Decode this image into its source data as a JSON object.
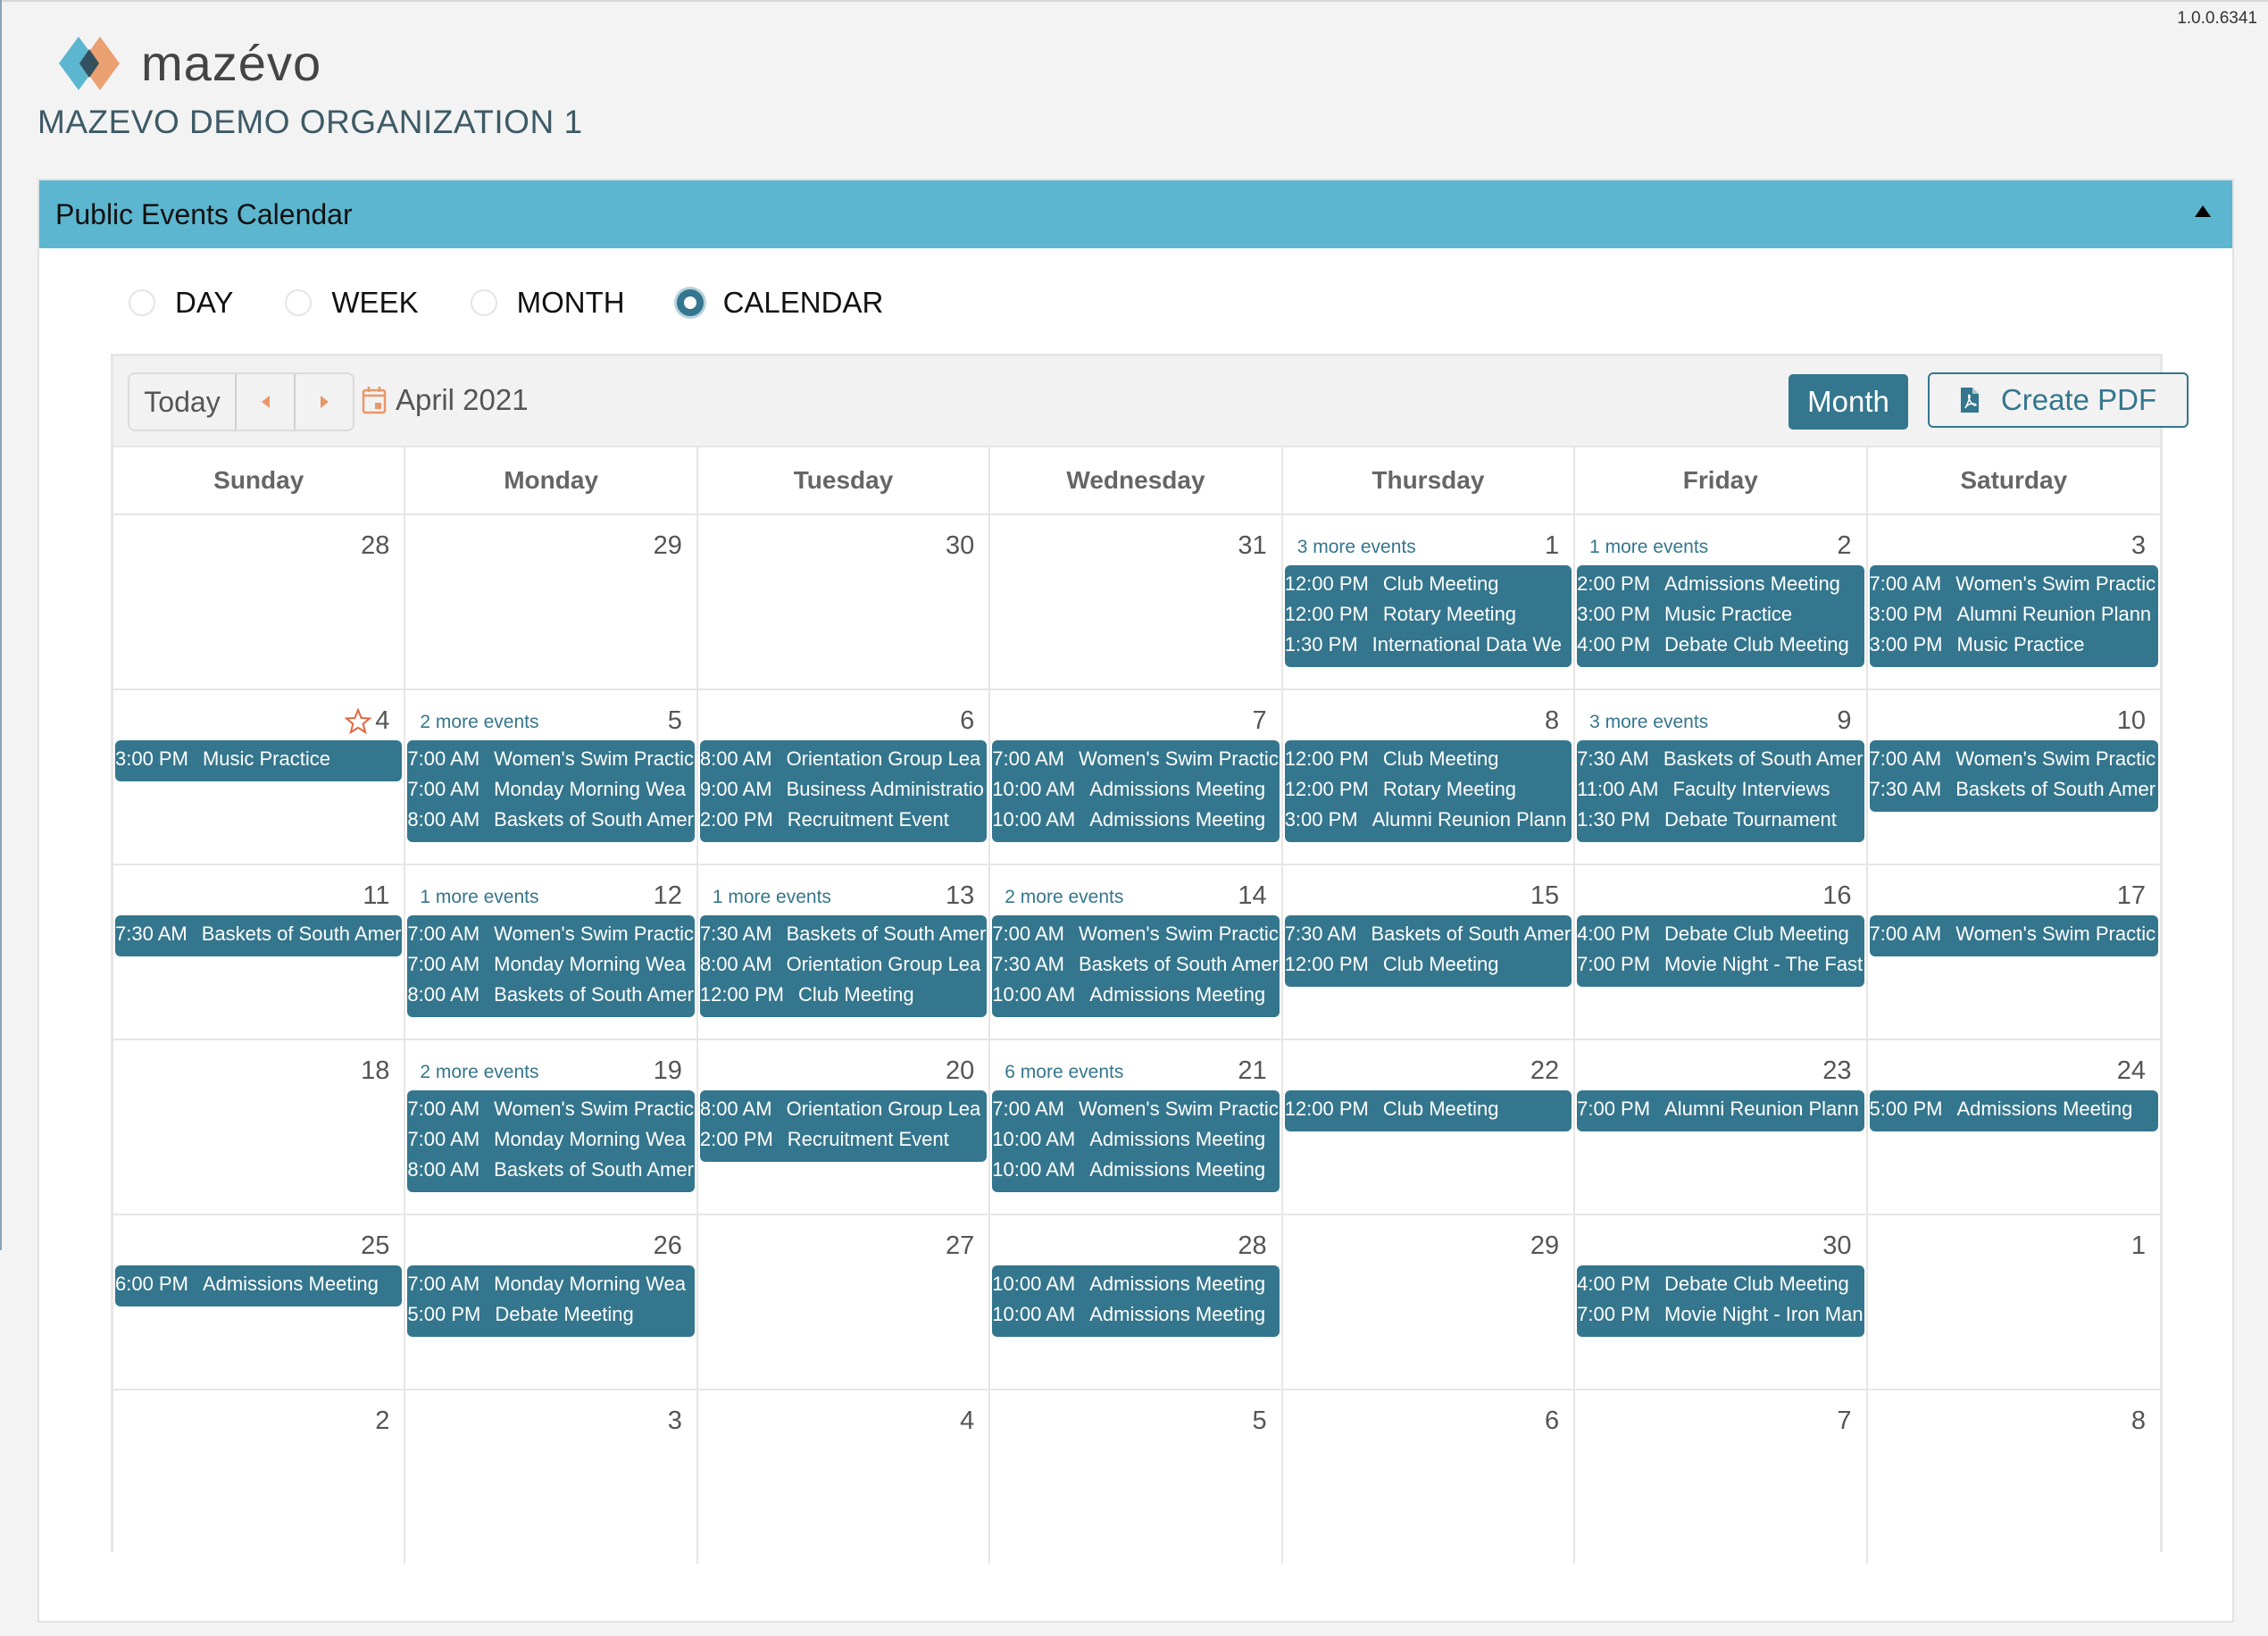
{
  "app": {
    "version": "1.0.0.6341",
    "logo_text": "mazévo",
    "organization": "MAZEVO DEMO ORGANIZATION 1",
    "colors": {
      "header_bar": "#5cb6cf",
      "accent": "#34768d",
      "nav_icon": "#e9976a",
      "star": "#e4663f"
    }
  },
  "panel": {
    "title": "Public Events Calendar",
    "collapse_icon": "triangle-up-icon"
  },
  "view_options": [
    {
      "label": "DAY",
      "checked": false
    },
    {
      "label": "WEEK",
      "checked": false
    },
    {
      "label": "MONTH",
      "checked": false
    },
    {
      "label": "CALENDAR",
      "checked": true
    }
  ],
  "toolbar": {
    "today_label": "Today",
    "prev_icon": "caret-left-icon",
    "next_icon": "caret-right-icon",
    "period_icon": "calendar-icon",
    "period_label": "April 2021",
    "month_label": "Month",
    "pdf_label": "Create PDF",
    "pdf_icon": "file-pdf-icon"
  },
  "days_of_week": [
    "Sunday",
    "Monday",
    "Tuesday",
    "Wednesday",
    "Thursday",
    "Friday",
    "Saturday"
  ],
  "weeks": [
    [
      {
        "day": "28",
        "more": "",
        "events": []
      },
      {
        "day": "29",
        "more": "",
        "events": []
      },
      {
        "day": "30",
        "more": "",
        "events": []
      },
      {
        "day": "31",
        "more": "",
        "events": []
      },
      {
        "day": "1",
        "more": "3 more events",
        "events": [
          {
            "time": "12:00 PM",
            "title": "Club Meeting"
          },
          {
            "time": "12:00 PM",
            "title": "Rotary Meeting"
          },
          {
            "time": "1:30 PM",
            "title": "International Data We"
          }
        ]
      },
      {
        "day": "2",
        "more": "1 more events",
        "events": [
          {
            "time": "2:00 PM",
            "title": "Admissions Meeting"
          },
          {
            "time": "3:00 PM",
            "title": "Music Practice"
          },
          {
            "time": "4:00 PM",
            "title": "Debate Club Meeting"
          }
        ]
      },
      {
        "day": "3",
        "more": "",
        "events": [
          {
            "time": "7:00 AM",
            "title": "Women's Swim Practic"
          },
          {
            "time": "3:00 PM",
            "title": "Alumni Reunion Plann"
          },
          {
            "time": "3:00 PM",
            "title": "Music Practice"
          }
        ]
      }
    ],
    [
      {
        "day": "4",
        "more": "",
        "today": true,
        "events": [
          {
            "time": "3:00 PM",
            "title": "Music Practice"
          }
        ]
      },
      {
        "day": "5",
        "more": "2 more events",
        "events": [
          {
            "time": "7:00 AM",
            "title": "Women's Swim Practic"
          },
          {
            "time": "7:00 AM",
            "title": "Monday Morning Wea"
          },
          {
            "time": "8:00 AM",
            "title": "Baskets of South Amer"
          }
        ]
      },
      {
        "day": "6",
        "more": "",
        "events": [
          {
            "time": "8:00 AM",
            "title": "Orientation Group Lea"
          },
          {
            "time": "9:00 AM",
            "title": "Business Administratio"
          },
          {
            "time": "2:00 PM",
            "title": "Recruitment Event"
          }
        ]
      },
      {
        "day": "7",
        "more": "",
        "events": [
          {
            "time": "7:00 AM",
            "title": "Women's Swim Practic"
          },
          {
            "time": "10:00 AM",
            "title": "Admissions Meeting"
          },
          {
            "time": "10:00 AM",
            "title": "Admissions Meeting"
          }
        ]
      },
      {
        "day": "8",
        "more": "",
        "events": [
          {
            "time": "12:00 PM",
            "title": "Club Meeting"
          },
          {
            "time": "12:00 PM",
            "title": "Rotary Meeting"
          },
          {
            "time": "3:00 PM",
            "title": "Alumni Reunion Plann"
          }
        ]
      },
      {
        "day": "9",
        "more": "3 more events",
        "events": [
          {
            "time": "7:30 AM",
            "title": "Baskets of South Amer"
          },
          {
            "time": "11:00 AM",
            "title": "Faculty Interviews"
          },
          {
            "time": "1:30 PM",
            "title": "Debate Tournament"
          }
        ]
      },
      {
        "day": "10",
        "more": "",
        "events": [
          {
            "time": "7:00 AM",
            "title": "Women's Swim Practic"
          },
          {
            "time": "7:30 AM",
            "title": "Baskets of South Amer"
          }
        ]
      }
    ],
    [
      {
        "day": "11",
        "more": "",
        "events": [
          {
            "time": "7:30 AM",
            "title": "Baskets of South Amer"
          }
        ]
      },
      {
        "day": "12",
        "more": "1 more events",
        "events": [
          {
            "time": "7:00 AM",
            "title": "Women's Swim Practic"
          },
          {
            "time": "7:00 AM",
            "title": "Monday Morning Wea"
          },
          {
            "time": "8:00 AM",
            "title": "Baskets of South Amer"
          }
        ]
      },
      {
        "day": "13",
        "more": "1 more events",
        "events": [
          {
            "time": "7:30 AM",
            "title": "Baskets of South Amer"
          },
          {
            "time": "8:00 AM",
            "title": "Orientation Group Lea"
          },
          {
            "time": "12:00 PM",
            "title": "Club Meeting"
          }
        ]
      },
      {
        "day": "14",
        "more": "2 more events",
        "events": [
          {
            "time": "7:00 AM",
            "title": "Women's Swim Practic"
          },
          {
            "time": "7:30 AM",
            "title": "Baskets of South Amer"
          },
          {
            "time": "10:00 AM",
            "title": "Admissions Meeting"
          }
        ]
      },
      {
        "day": "15",
        "more": "",
        "events": [
          {
            "time": "7:30 AM",
            "title": "Baskets of South Amer"
          },
          {
            "time": "12:00 PM",
            "title": "Club Meeting"
          }
        ]
      },
      {
        "day": "16",
        "more": "",
        "events": [
          {
            "time": "4:00 PM",
            "title": "Debate Club Meeting"
          },
          {
            "time": "7:00 PM",
            "title": "Movie Night - The Fast"
          }
        ]
      },
      {
        "day": "17",
        "more": "",
        "events": [
          {
            "time": "7:00 AM",
            "title": "Women's Swim Practic"
          }
        ]
      }
    ],
    [
      {
        "day": "18",
        "more": "",
        "events": []
      },
      {
        "day": "19",
        "more": "2 more events",
        "events": [
          {
            "time": "7:00 AM",
            "title": "Women's Swim Practic"
          },
          {
            "time": "7:00 AM",
            "title": "Monday Morning Wea"
          },
          {
            "time": "8:00 AM",
            "title": "Baskets of South Amer"
          }
        ]
      },
      {
        "day": "20",
        "more": "",
        "events": [
          {
            "time": "8:00 AM",
            "title": "Orientation Group Lea"
          },
          {
            "time": "2:00 PM",
            "title": "Recruitment Event"
          }
        ]
      },
      {
        "day": "21",
        "more": "6 more events",
        "events": [
          {
            "time": "7:00 AM",
            "title": "Women's Swim Practic"
          },
          {
            "time": "10:00 AM",
            "title": "Admissions Meeting"
          },
          {
            "time": "10:00 AM",
            "title": "Admissions Meeting"
          }
        ]
      },
      {
        "day": "22",
        "more": "",
        "events": [
          {
            "time": "12:00 PM",
            "title": "Club Meeting"
          }
        ]
      },
      {
        "day": "23",
        "more": "",
        "events": [
          {
            "time": "7:00 PM",
            "title": "Alumni Reunion Plann"
          }
        ]
      },
      {
        "day": "24",
        "more": "",
        "events": [
          {
            "time": "5:00 PM",
            "title": "Admissions Meeting"
          }
        ]
      }
    ],
    [
      {
        "day": "25",
        "more": "",
        "events": [
          {
            "time": "6:00 PM",
            "title": "Admissions Meeting"
          }
        ]
      },
      {
        "day": "26",
        "more": "",
        "events": [
          {
            "time": "7:00 AM",
            "title": "Monday Morning Wea"
          },
          {
            "time": "5:00 PM",
            "title": "Debate Meeting"
          }
        ]
      },
      {
        "day": "27",
        "more": "",
        "events": []
      },
      {
        "day": "28",
        "more": "",
        "events": [
          {
            "time": "10:00 AM",
            "title": "Admissions Meeting"
          },
          {
            "time": "10:00 AM",
            "title": "Admissions Meeting"
          }
        ]
      },
      {
        "day": "29",
        "more": "",
        "events": []
      },
      {
        "day": "30",
        "more": "",
        "events": [
          {
            "time": "4:00 PM",
            "title": "Debate Club Meeting"
          },
          {
            "time": "7:00 PM",
            "title": "Movie Night - Iron Man"
          }
        ]
      },
      {
        "day": "1",
        "more": "",
        "events": []
      }
    ],
    [
      {
        "day": "2",
        "more": "",
        "events": []
      },
      {
        "day": "3",
        "more": "",
        "events": []
      },
      {
        "day": "4",
        "more": "",
        "events": []
      },
      {
        "day": "5",
        "more": "",
        "events": []
      },
      {
        "day": "6",
        "more": "",
        "events": []
      },
      {
        "day": "7",
        "more": "",
        "events": []
      },
      {
        "day": "8",
        "more": "",
        "events": []
      }
    ]
  ]
}
